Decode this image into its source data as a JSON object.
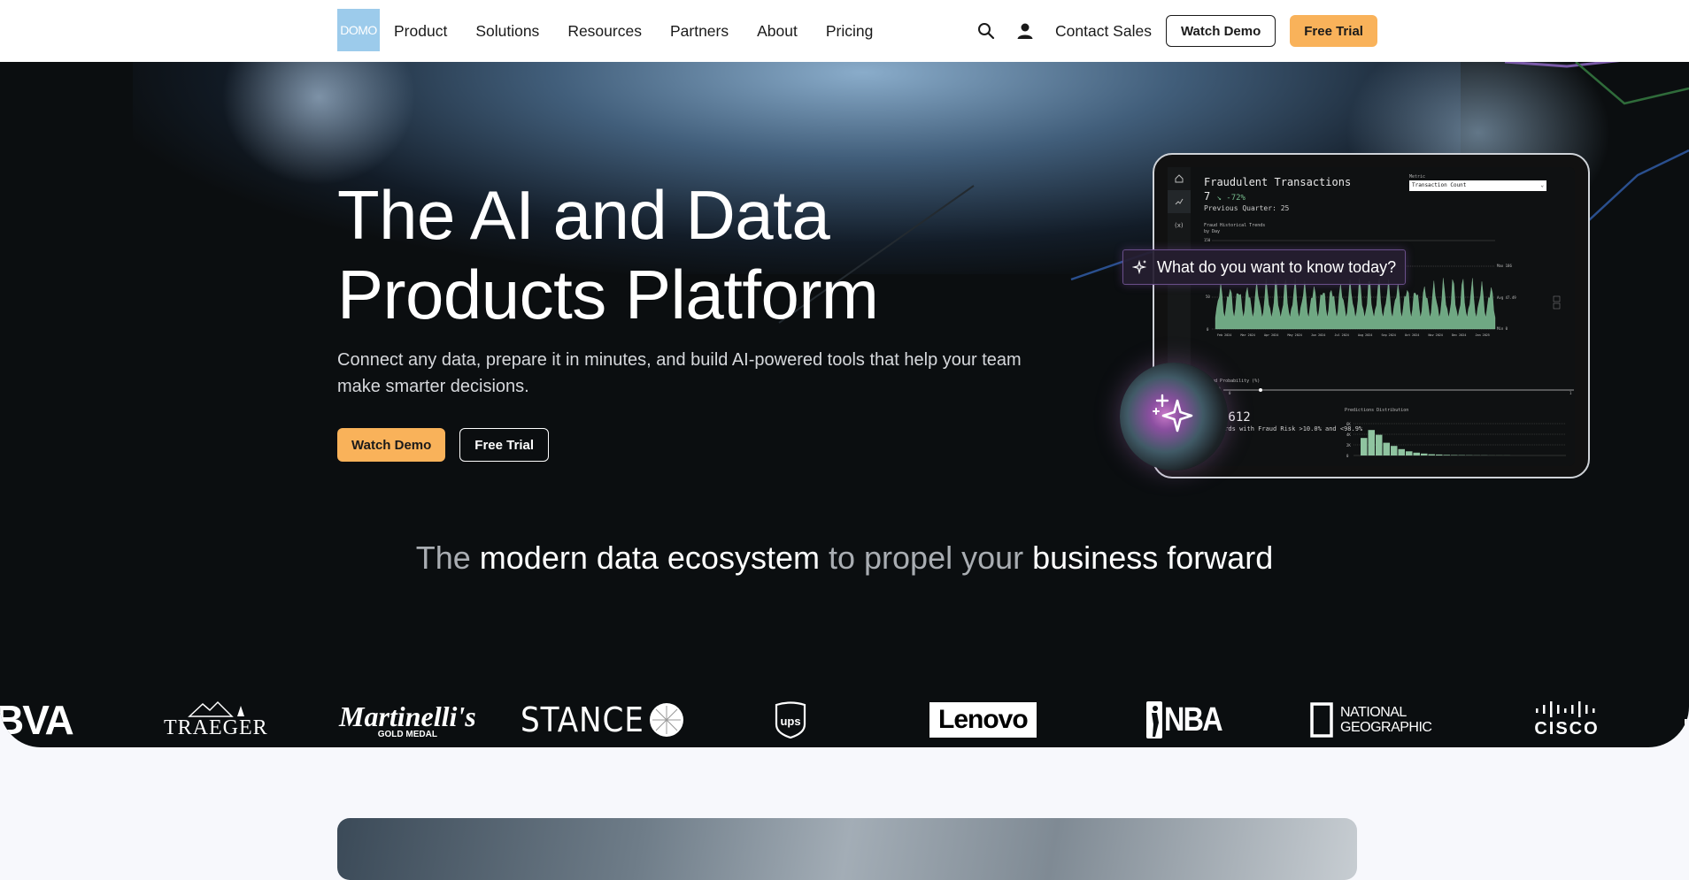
{
  "nav": {
    "logo": "DOMO",
    "items": [
      "Product",
      "Solutions",
      "Resources",
      "Partners",
      "About",
      "Pricing"
    ],
    "contact": "Contact Sales",
    "watch_demo": "Watch Demo",
    "free_trial": "Free Trial"
  },
  "hero": {
    "title_line1": "The AI and Data",
    "title_line2": "Products Platform",
    "subtitle": "Connect any data, prepare it in minutes, and build AI-powered tools that help your team make smarter decisions.",
    "watch_demo": "Watch Demo",
    "free_trial": "Free Trial"
  },
  "dashboard": {
    "title": "Fraudulent Transactions",
    "value": "7",
    "change": "↘ -72%",
    "previous": "Previous Quarter: 25",
    "metric_label": "Metric",
    "metric_value": "Transaction Count",
    "trend_label": "Fraud Historical Trends",
    "trend_sub": "by Day",
    "y_top": "150",
    "y_mid": "50",
    "y_bot": "0",
    "max_label": "Max 186",
    "avg_label": "Avg 47.49",
    "min_label": "Min 0",
    "months": [
      "Feb 2024",
      "Mar 2024",
      "Apr 2024",
      "May 2024",
      "Jun 2024",
      "Jul 2024",
      "Aug 2024",
      "Sep 2024",
      "Oct 2024",
      "Nov 2024",
      "Dec 2024",
      "Jan 2025"
    ],
    "prob_label": "Fraud Probability (%)",
    "slider_min": "0",
    "slider_max": "1",
    "records": ",612",
    "records_sub": "ords with Fraud Risk >10.0% and <98.9%",
    "dist_label": "Predictions Distribution",
    "hist_y": [
      "6K",
      "4K",
      "2K",
      "0"
    ]
  },
  "ask": {
    "prompt": "What do you want to know today?"
  },
  "ecosystem": {
    "w1": "The",
    "w2": "modern data ecosystem",
    "w3": "to propel your",
    "w4": "business forward"
  },
  "logos": [
    "BVA",
    "TRAEGER",
    "Martinelli's",
    "GOLD MEDAL",
    "STANCE",
    "ups",
    "Lenovo",
    "NBA",
    "NATIONAL",
    "GEOGRAPHIC",
    "CISCO"
  ],
  "colors": {
    "accent": "#f9b25a",
    "hero_bg": "#0b0e10",
    "logo_bg": "#9ccbeb",
    "chart_green": "#7ab08c"
  }
}
